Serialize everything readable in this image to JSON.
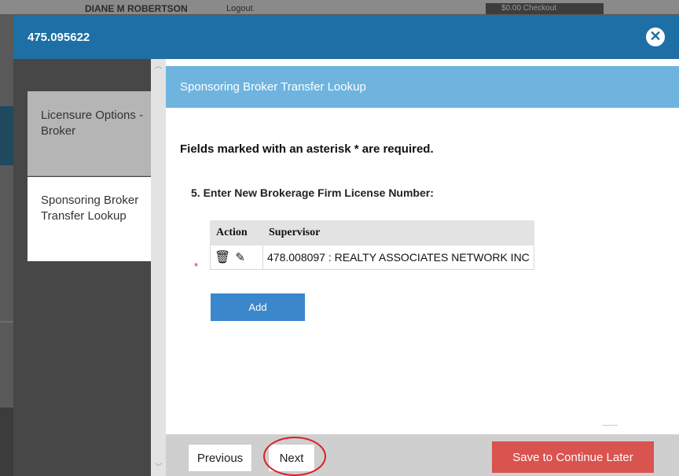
{
  "background": {
    "user_name": "DIANE M ROBERTSON",
    "logout": "Logout",
    "cart": "$0.00 Checkout"
  },
  "modal": {
    "title": "475.095622",
    "close_icon": "close-circle-icon"
  },
  "sidebar": {
    "items": [
      {
        "label": "Licensure Options - Broker",
        "active": false
      },
      {
        "label": "Sponsoring Broker Transfer Lookup",
        "active": true
      }
    ]
  },
  "content": {
    "header_title": "Sponsoring Broker Transfer Lookup",
    "required_note": "Fields marked with an asterisk * are required.",
    "question": "5. Enter New Brokerage Firm License Number:",
    "required_marker": "*",
    "table": {
      "columns": [
        "Action",
        "Supervisor"
      ],
      "rows": [
        {
          "supervisor": "478.008097 : REALTY ASSOCIATES NETWORK INC",
          "icons": [
            "trash-icon",
            "edit-icon"
          ]
        }
      ]
    },
    "add_label": "Add"
  },
  "footer": {
    "previous_label": "Previous",
    "next_label": "Next",
    "save_label": "Save to Continue Later"
  },
  "colors": {
    "header_blue": "#1d6fa5",
    "section_blue": "#6eb4df",
    "add_button": "#3a87cc",
    "save_button": "#d9534f",
    "highlight_circle": "#d81f26"
  }
}
